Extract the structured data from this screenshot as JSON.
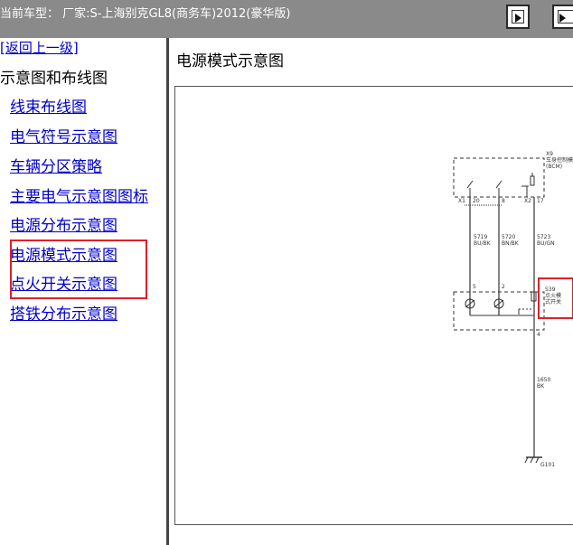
{
  "header": {
    "vehicle": "当前车型： 厂家:S-上海别克GL8(商务车)2012(豪华版)",
    "buttons": [
      "next-page-icon",
      "last-page-icon"
    ]
  },
  "sidebar": {
    "back_link": "[返回上一级]",
    "section_title": "示意图和布线图",
    "items": [
      "线束布线图",
      "电气符号示意图",
      "车辆分区策略",
      "主要电气示意图图标",
      "电源分布示意图",
      "电源模式示意图",
      "点火开关示意图",
      "搭铁分布示意图"
    ]
  },
  "main": {
    "title": "电源模式示意图"
  },
  "diagram": {
    "module_id": "X9",
    "module_name": "车身控制模块",
    "module_abbr": "(BCM)",
    "pin_x1": "X1",
    "pin_20": "20",
    "pin_8": "8",
    "pin_x2": "X2",
    "pin_17": "17",
    "wires": [
      {
        "circuit": "5719",
        "color": "BU/BK"
      },
      {
        "circuit": "5720",
        "color": "BN/BK"
      },
      {
        "circuit": "5723",
        "color": "BU/GN"
      }
    ],
    "switch_pins": [
      "5",
      "2",
      "1"
    ],
    "pin_4": "4",
    "switch_id": "S39",
    "switch_name_1": "点火模",
    "switch_name_2": "式开关",
    "ground_circuit": "1650",
    "ground_color": "BK",
    "ground_id": "G101"
  }
}
